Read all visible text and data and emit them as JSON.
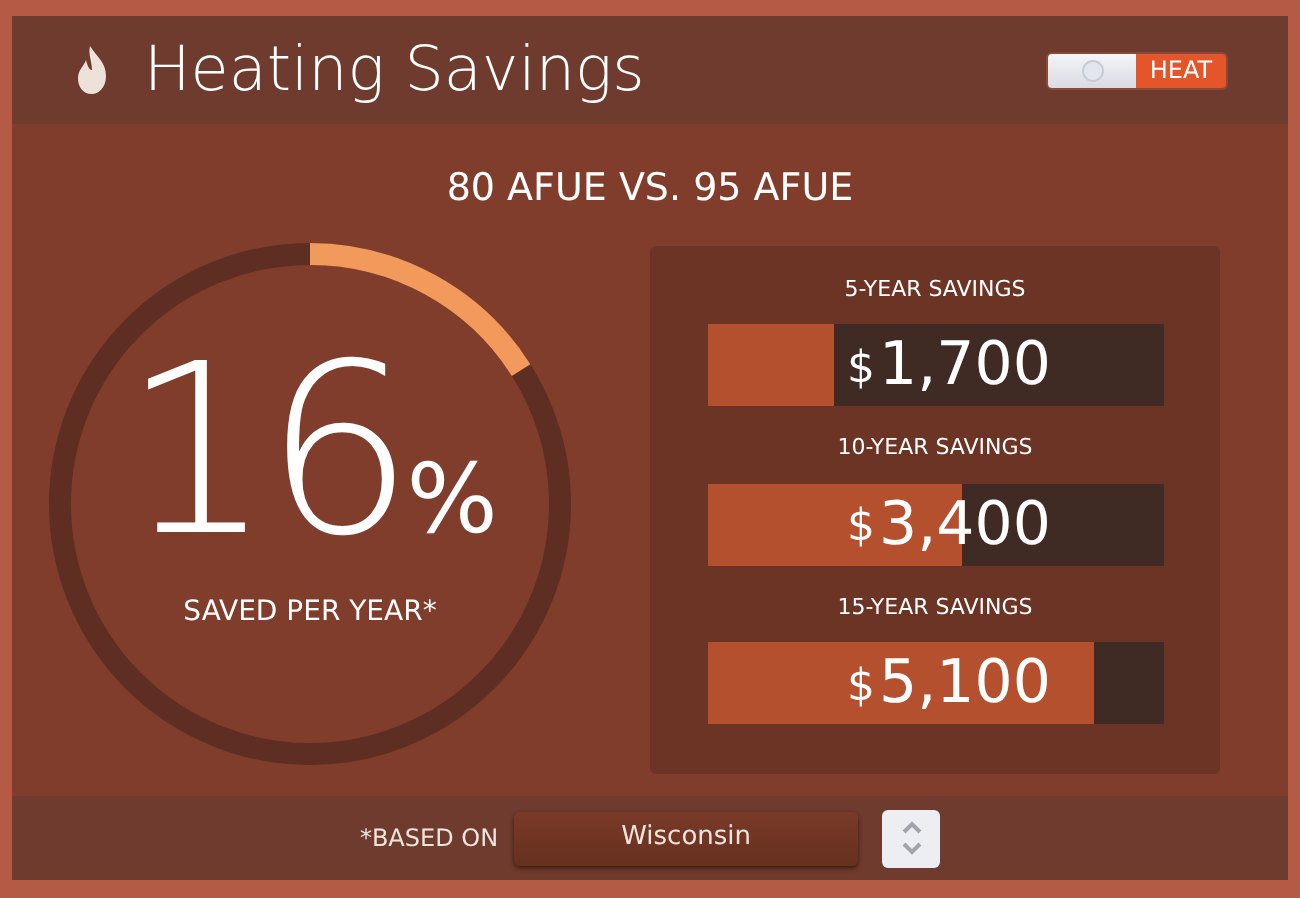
{
  "header": {
    "title": "Heating Savings",
    "toggle": {
      "label": "HEAT",
      "on": true
    }
  },
  "comparison": "80 AFUE VS. 95 AFUE",
  "gauge": {
    "value": "16",
    "unit": "%",
    "caption": "SAVED PER YEAR*"
  },
  "savings": [
    {
      "label": "5-YEAR SAVINGS",
      "currency": "$",
      "amount": "1,700",
      "level": 0.28
    },
    {
      "label": "10-YEAR SAVINGS",
      "currency": "$",
      "amount": "3,400",
      "level": 0.56
    },
    {
      "label": "15-YEAR SAVINGS",
      "currency": "$",
      "amount": "5,100",
      "level": 0.85
    }
  ],
  "footer": {
    "label": "*BASED ON",
    "state": "Wisconsin"
  }
}
